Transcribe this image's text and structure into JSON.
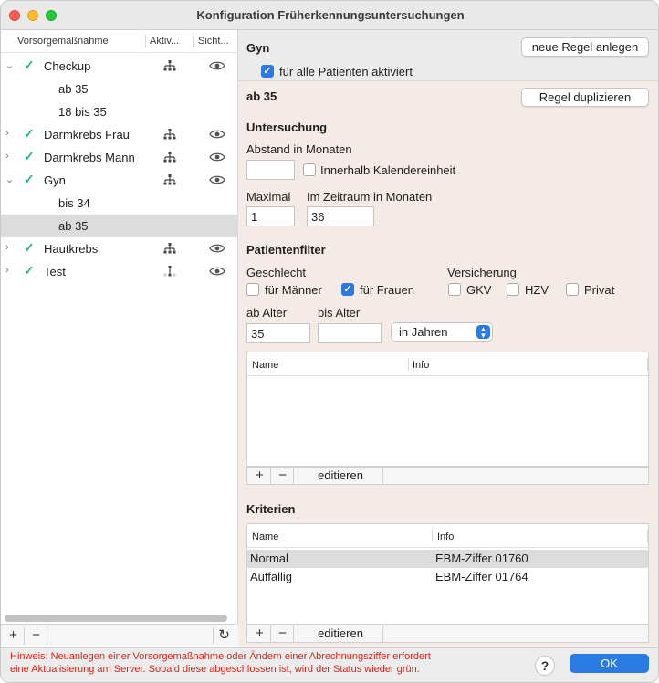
{
  "window": {
    "title": "Konfiguration Früherkennungsuntersuchungen"
  },
  "list": {
    "columns": [
      "Vorsorgemaßnahme",
      "Aktiv...",
      "Sicht..."
    ],
    "rows": [
      {
        "label": "Checkup",
        "expanded": true,
        "active": true,
        "tree_icon": "hierarchy-icon",
        "eye_icon": "eye-icon"
      },
      {
        "label": "ab 35",
        "child": true
      },
      {
        "label": "18 bis 35",
        "child": true
      },
      {
        "label": "Darmkrebs Frau",
        "expanded": false,
        "active": true,
        "tree_icon": "hierarchy-icon",
        "eye_icon": "eye-icon"
      },
      {
        "label": "Darmkrebs Mann",
        "expanded": false,
        "active": true,
        "tree_icon": "hierarchy-icon",
        "eye_icon": "eye-icon"
      },
      {
        "label": "Gyn",
        "expanded": true,
        "active": true,
        "tree_icon": "hierarchy-icon",
        "eye_icon": "eye-icon"
      },
      {
        "label": "bis 34",
        "child": true
      },
      {
        "label": "ab 35",
        "child": true,
        "selected": true
      },
      {
        "label": "Hautkrebs",
        "expanded": false,
        "active": true,
        "tree_icon": "hierarchy-icon",
        "eye_icon": "eye-icon"
      },
      {
        "label": "Test",
        "expanded": false,
        "active": true,
        "tree_icon": "hierarchy-partial-icon",
        "eye_icon": "eye-icon"
      }
    ],
    "footer": {
      "add": "+",
      "remove": "−",
      "refresh": "↻"
    }
  },
  "detail": {
    "group_title": "Gyn",
    "new_rule_button": "neue Regel anlegen",
    "all_patients_label": "für alle Patienten aktiviert",
    "all_patients_checked": true,
    "rule_title": "ab 35",
    "duplicate_button": "Regel duplizieren",
    "untersuchung": {
      "heading": "Untersuchung",
      "abstand_label": "Abstand in Monaten",
      "abstand_value": "",
      "kalender_label": "Innerhalb Kalendereinheit",
      "kalender_checked": false,
      "maximal_label": "Maximal",
      "maximal_value": "1",
      "zeitraum_label": "Im Zeitraum in Monaten",
      "zeitraum_value": "36"
    },
    "filter": {
      "heading": "Patientenfilter",
      "geschlecht_label": "Geschlecht",
      "maenner_label": "für Männer",
      "maenner_checked": false,
      "frauen_label": "für Frauen",
      "frauen_checked": true,
      "versicherung_label": "Versicherung",
      "gkv_label": "GKV",
      "hzv_label": "HZV",
      "privat_label": "Privat",
      "ab_alter_label": "ab Alter",
      "ab_alter_value": "35",
      "bis_alter_label": "bis Alter",
      "bis_alter_value": "",
      "unit_select": "in Jahren"
    },
    "filter_table": {
      "columns": [
        "Name",
        "Info"
      ],
      "rows": [],
      "footer": {
        "add": "+",
        "remove": "−",
        "edit": "editieren"
      }
    },
    "kriterien": {
      "heading": "Kriterien",
      "columns": [
        "Name",
        "Info"
      ],
      "rows": [
        {
          "name": "Normal",
          "info": "EBM-Ziffer 01760",
          "selected": true
        },
        {
          "name": "Auffällig",
          "info": "EBM-Ziffer 01764",
          "selected": false
        }
      ],
      "footer": {
        "add": "+",
        "remove": "−",
        "edit": "editieren"
      }
    }
  },
  "bottom": {
    "hint_line1": "Hinweis: Neuanlegen einer Vorsorgemaßnahme oder Ändern einer Abrechnungsziffer erfordert",
    "hint_line2": "eine Aktualisierung am Server. Sobald diese abgeschlossen ist, wird der Status wieder grün.",
    "help_label": "?",
    "ok_label": "OK"
  },
  "colors": {
    "accent": "#2a7ae2",
    "check_green": "#2fb37e",
    "hint_red": "#d0271d",
    "detail_bg": "#f4ebe7"
  }
}
